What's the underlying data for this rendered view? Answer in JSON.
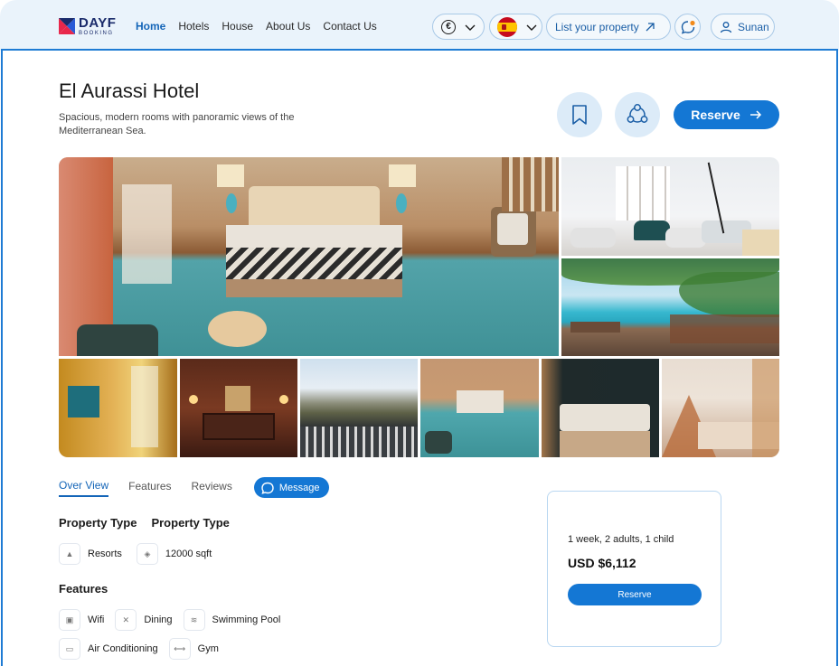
{
  "brand": {
    "name": "DAYF",
    "sub": "BOOKING"
  },
  "nav": [
    {
      "label": "Home",
      "active": true
    },
    {
      "label": "Hotels",
      "active": false
    },
    {
      "label": "House",
      "active": false
    },
    {
      "label": "About Us",
      "active": false
    },
    {
      "label": "Contact Us",
      "active": false
    }
  ],
  "header": {
    "currency_symbol": "€",
    "language_flag": "spain-flag",
    "list_property_label": "List your property",
    "user_name": "Sunan",
    "notification_dot_color": "#f28a1b"
  },
  "hotel": {
    "title": "El Aurassi Hotel",
    "description": "Spacious, modern rooms with panoramic views of the Mediterranean Sea.",
    "reserve_label": "Reserve"
  },
  "gallery": {
    "photos": [
      "bedroom-main",
      "lounge",
      "pool",
      "sunny-room",
      "lobby",
      "terrace-view",
      "bedroom-2",
      "bedroom-3",
      "bedroom-4"
    ]
  },
  "tabs": [
    {
      "label": "Over View",
      "active": true
    },
    {
      "label": "Features",
      "active": false
    },
    {
      "label": "Reviews",
      "active": false
    }
  ],
  "message_label": "Message",
  "property": {
    "heads": [
      "Property Type",
      "Property Type"
    ],
    "items": [
      {
        "icon": "resort-icon",
        "label": "Resorts"
      },
      {
        "icon": "area-icon",
        "label": "12000 sqft"
      }
    ]
  },
  "features": {
    "title": "Features",
    "items": [
      {
        "icon": "wifi-icon",
        "label": "Wifi"
      },
      {
        "icon": "dining-icon",
        "label": "Dining"
      },
      {
        "icon": "pool-icon",
        "label": "Swimming Pool"
      },
      {
        "icon": "ac-icon",
        "label": "Air Conditioning"
      },
      {
        "icon": "gym-icon",
        "label": "Gym"
      }
    ]
  },
  "booking": {
    "summary": "1 week, 2 adults, 1 child",
    "price": "USD $6,112",
    "reserve_label": "Reserve"
  },
  "colors": {
    "accent": "#1477d4",
    "header_bg": "#eaf3fb",
    "border": "#1e7bd4"
  }
}
